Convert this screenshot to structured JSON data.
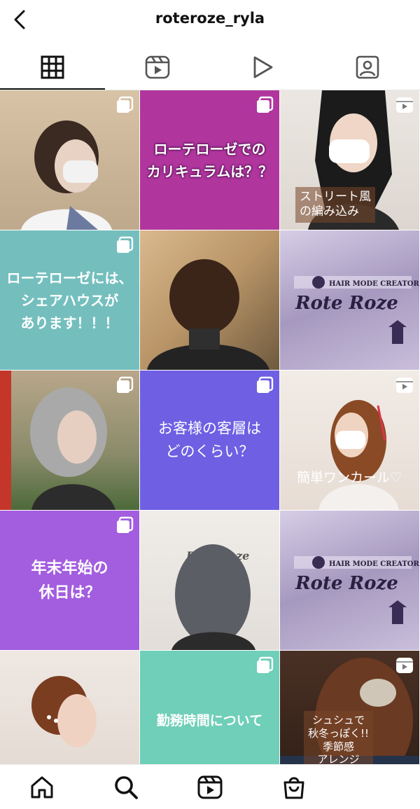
{
  "header": {
    "title": "roteroze_ryla"
  },
  "tabs": [
    {
      "name": "grid",
      "active": true
    },
    {
      "name": "reels",
      "active": false
    },
    {
      "name": "video",
      "active": false
    },
    {
      "name": "tagged",
      "active": false
    }
  ],
  "posts": [
    {
      "kind": "photo",
      "overlay": "carousel-icon"
    },
    {
      "kind": "text",
      "color": "#b0369e",
      "text": "ローテローゼでの\nカリキュラムは？？",
      "overlay": "carousel-icon"
    },
    {
      "kind": "photo",
      "overlay": "reel-icon",
      "caption": "ストリート風\nの編み込み"
    },
    {
      "kind": "text",
      "color": "#74bfbe",
      "text": "ローテローゼには、\nシェアハウスが\nあります！！！",
      "overlay": "carousel-icon"
    },
    {
      "kind": "photo"
    },
    {
      "kind": "photo",
      "logo": "HAIR MODE CREATOR\nRote Roze"
    },
    {
      "kind": "photo",
      "overlay": "carousel-icon"
    },
    {
      "kind": "text",
      "color": "#6e5fe3",
      "text": "お客様の客層は\nどのくらい？",
      "overlay": "carousel-icon"
    },
    {
      "kind": "photo",
      "overlay": "reel-icon",
      "caption": "簡単ワンカール♡"
    },
    {
      "kind": "text",
      "color": "#a35ddf",
      "text": "年末年始の\n休日は？",
      "overlay": "carousel-icon"
    },
    {
      "kind": "photo",
      "logo": "HAIR MODE CREATOR\nRote Roze"
    },
    {
      "kind": "photo",
      "logo": "HAIR MODE CREATOR\nRote Roze"
    },
    {
      "kind": "photo"
    },
    {
      "kind": "text",
      "color": "#6fcfb8",
      "text": "勤務時間について",
      "overlay": "carousel-icon"
    },
    {
      "kind": "photo",
      "overlay": "reel-icon",
      "caption": "シュシュで\n秋冬っぽく!!\n季節感\nアレンジ"
    }
  ],
  "bottom_nav": [
    "home-icon",
    "search-icon",
    "reels-icon",
    "shop-icon"
  ]
}
